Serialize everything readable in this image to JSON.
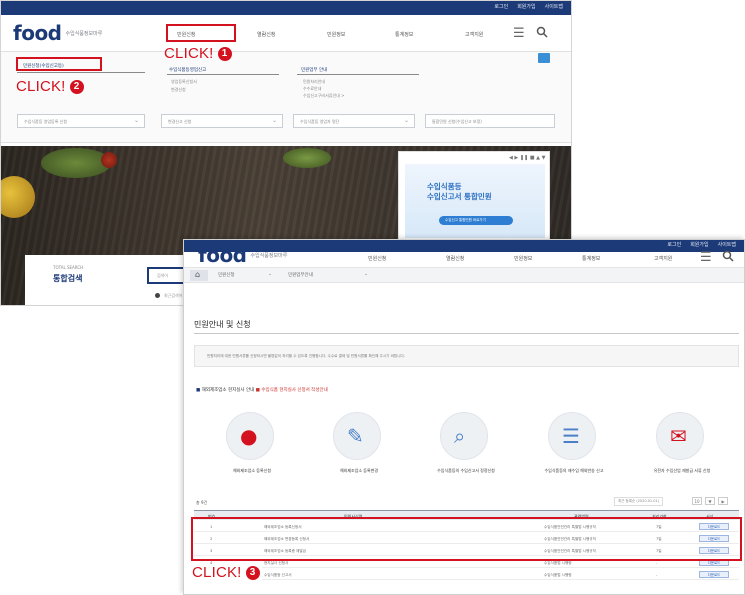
{
  "screen_a": {
    "util_links": [
      "로그인",
      "회원가입",
      "사이트맵"
    ],
    "logo": {
      "word": "food",
      "sub": "수입식품정보마루"
    },
    "gnb": [
      "민원신청",
      "열람신청",
      "민원정보",
      "통계정보",
      "고객지원"
    ],
    "menu_icon": "hamburger-icon",
    "search_icon": "search-icon",
    "mega_menu": {
      "col1_title": "민원신청(수입신고등)",
      "col2_title": "수입식품등영업신고",
      "col2_items": [
        "영업등록신청서",
        "변경신청"
      ],
      "col3_title": "민원업무 안내",
      "col3_items": [
        "민원처리안내",
        "수수료안내",
        "수입신고구비서류안내 >"
      ],
      "selects": [
        "수입식품등 영업등록 신청",
        "변경신고 신청",
        "수입식품등 영업자 명단",
        "통합민원 신청(수입신고 보정)"
      ]
    },
    "promo": {
      "tools": "◀ ▶ ❚❚ ■ ▲ ▼",
      "title_line1": "수입식품등",
      "title_line2": "수입신고서 통합민원",
      "button": "수입신고 통합민원 바로가기"
    },
    "search": {
      "label_en": "TOTAL SEARCH",
      "label": "통합검색",
      "placeholder": "검색어",
      "indicator_text": "최근검색어"
    }
  },
  "screen_b": {
    "util_links": [
      "로그인",
      "회원가입",
      "사이트맵"
    ],
    "logo": {
      "word": "food",
      "sub": "수입식품정보마루"
    },
    "gnb": [
      "민원신청",
      "열람신청",
      "민원정보",
      "통계정보",
      "고객지원"
    ],
    "breadcrumb": [
      "민원신청",
      "민원업무안내"
    ],
    "page_title": "민원안내 및 신청",
    "description": "민원처리에 대한 민원서류를 신청하시면 불편없이 처리할 수 있도록 진행합니다. 수수료 결제 및 민원서류를 확인해 주시기 바랍니다.",
    "section_heading": "해외제조업소 현지실사 안내",
    "section_note": "■ 수입식품 현지실사 신청서 작성안내",
    "cards": [
      {
        "icon": "stamp-icon",
        "glyph": "●",
        "label": "해외제조업소 등록신청"
      },
      {
        "icon": "document-icon",
        "glyph": "✎",
        "label": "해외제조업소 등록변경"
      },
      {
        "icon": "search-doc-icon",
        "glyph": "⌕",
        "label": "수입식품등의 수입신고서 정정신청"
      },
      {
        "icon": "list-icon",
        "glyph": "☰",
        "label": "수입식품등의 재수입 해외반송 신고"
      },
      {
        "icon": "certificate-icon",
        "glyph": "✉",
        "label": "유전자 수입산업 재발급 서류 신청"
      }
    ],
    "list_meta": "총 9건",
    "list_sort": "최근 등록순 (2020.01.01)",
    "pager": [
      "10",
      "▼",
      "▶"
    ],
    "columns": [
      "번호",
      "민원서식명",
      "관련법령",
      "처리기한",
      "서식"
    ],
    "rows": [
      {
        "no": "1",
        "title": "해외제조업소 등록신청서",
        "law": "수입식품안전관리 특별법 시행규칙",
        "days": "7일",
        "btn": "다운로드"
      },
      {
        "no": "2",
        "title": "해외제조업소 변경등록 신청서",
        "law": "수입식품안전관리 특별법 시행규칙",
        "days": "7일",
        "btn": "다운로드"
      },
      {
        "no": "3",
        "title": "해외제조업소 등록증 재발급",
        "law": "수입식품안전관리 특별법 시행규칙",
        "days": "7일",
        "btn": "다운로드"
      },
      {
        "no": "4",
        "title": "현지실사 신청서",
        "law": "수입식품법 시행령",
        "days": "-",
        "btn": "다운로드"
      },
      {
        "no": "5",
        "title": "수입식품등 신고서",
        "law": "수입식품법 시행령",
        "days": "-",
        "btn": "다운로드"
      }
    ]
  },
  "annotations": [
    {
      "text": "CLICK!",
      "num": "1"
    },
    {
      "text": "CLICK!",
      "num": "2"
    },
    {
      "text": "CLICK!",
      "num": "3"
    }
  ],
  "colors": {
    "accent_red": "#d4111e",
    "brand_navy": "#1d3a78",
    "brand_blue": "#2a5bb5"
  }
}
